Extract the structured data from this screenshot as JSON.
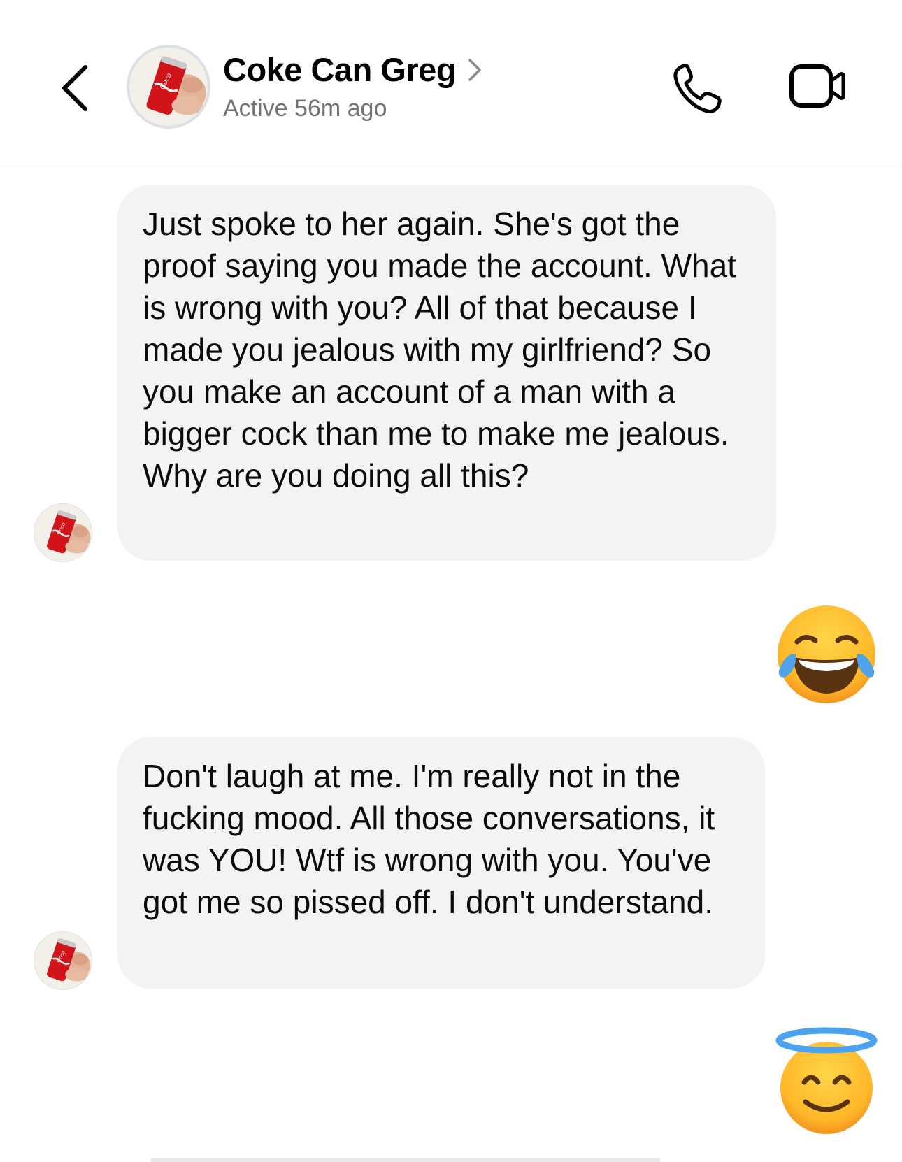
{
  "header": {
    "contact_name": "Coke Can Greg",
    "status": "Active 56m ago",
    "icons": [
      "back-chevron-icon",
      "chevron-right-icon",
      "phone-icon",
      "video-camera-icon"
    ]
  },
  "messages": [
    {
      "sender": "Coke Can Greg",
      "type": "text",
      "text": "Just spoke to her again. She's got the proof saying you made the account. What is wrong with you? All of that because I made you jealous with my girlfriend? So you make an account of a man with a bigger cock than me to make me jealous. Why are you doing all this?"
    },
    {
      "sender": "me",
      "type": "emoji",
      "emoji": "face-with-tears-of-joy"
    },
    {
      "sender": "Coke Can Greg",
      "type": "text",
      "text": "Don't laugh at me. I'm really not in the fucking mood. All those conversations, it was YOU! Wtf is wrong with you. You've got me so pissed off. I don't understand."
    },
    {
      "sender": "me",
      "type": "emoji",
      "emoji": "smiling-face-with-halo"
    }
  ],
  "colors": {
    "bubble_bg": "#f1f3f4",
    "status_text": "#737373",
    "divider": "#e6e6e6"
  }
}
